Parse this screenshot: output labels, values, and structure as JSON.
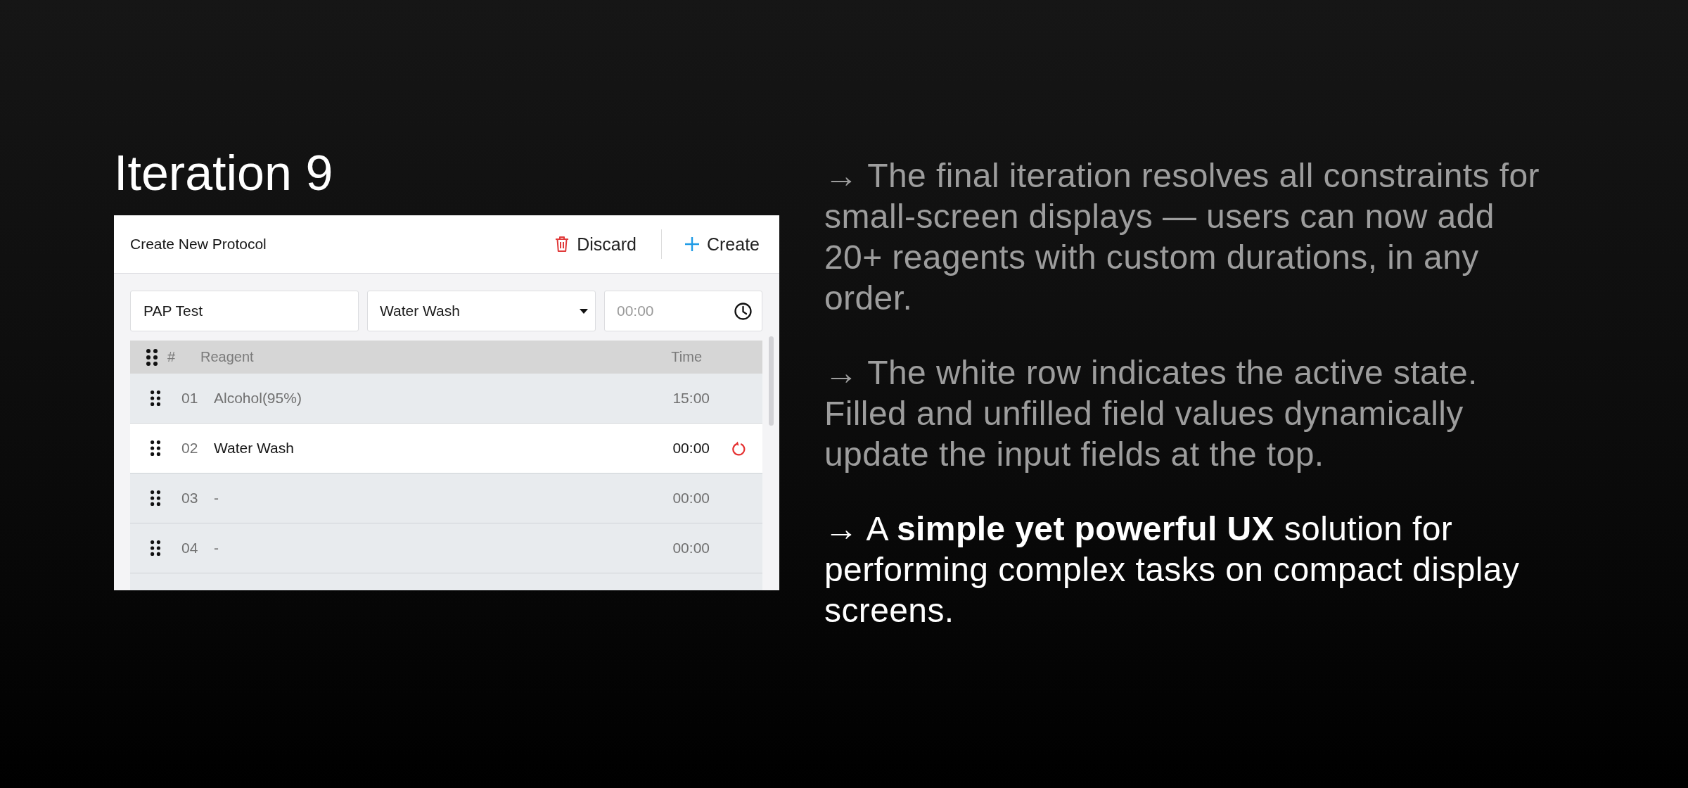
{
  "title": "Iteration 9",
  "panel": {
    "title": "Create New Protocol",
    "actions": [
      {
        "kind": "discard",
        "label": "Discard"
      },
      {
        "kind": "create",
        "label": "Create"
      }
    ],
    "fields": [
      {
        "kind": "text",
        "value": "PAP Test"
      },
      {
        "kind": "select",
        "value": "Water Wash"
      },
      {
        "kind": "time",
        "placeholder": "00:00"
      }
    ],
    "table": {
      "columns": [
        "#",
        "Reagent",
        "Time"
      ],
      "rows": [
        {
          "number": "01",
          "reagent": "Alcohol(95%)",
          "time": "15:00",
          "selected": false
        },
        {
          "number": "02",
          "reagent": "Water Wash",
          "time": "00:00",
          "selected": true
        },
        {
          "number": "03",
          "reagent": "-",
          "time": "00:00",
          "selected": false
        },
        {
          "number": "04",
          "reagent": "-",
          "time": "00:00",
          "selected": false
        }
      ]
    }
  },
  "notes": [
    {
      "text": "→ The final iteration resolves all constraints for small-screen displays — users can now add 20+ reagents with custom durations, in any order.",
      "highlighted": false
    },
    {
      "text": "→ The white row indicates the active state. Filled and unfilled field values dynamically update the input fields at the top.",
      "highlighted": false
    },
    {
      "text": "→ A **simple yet powerful UX** solution for performing complex tasks on compact display screens.",
      "highlighted": true
    }
  ]
}
